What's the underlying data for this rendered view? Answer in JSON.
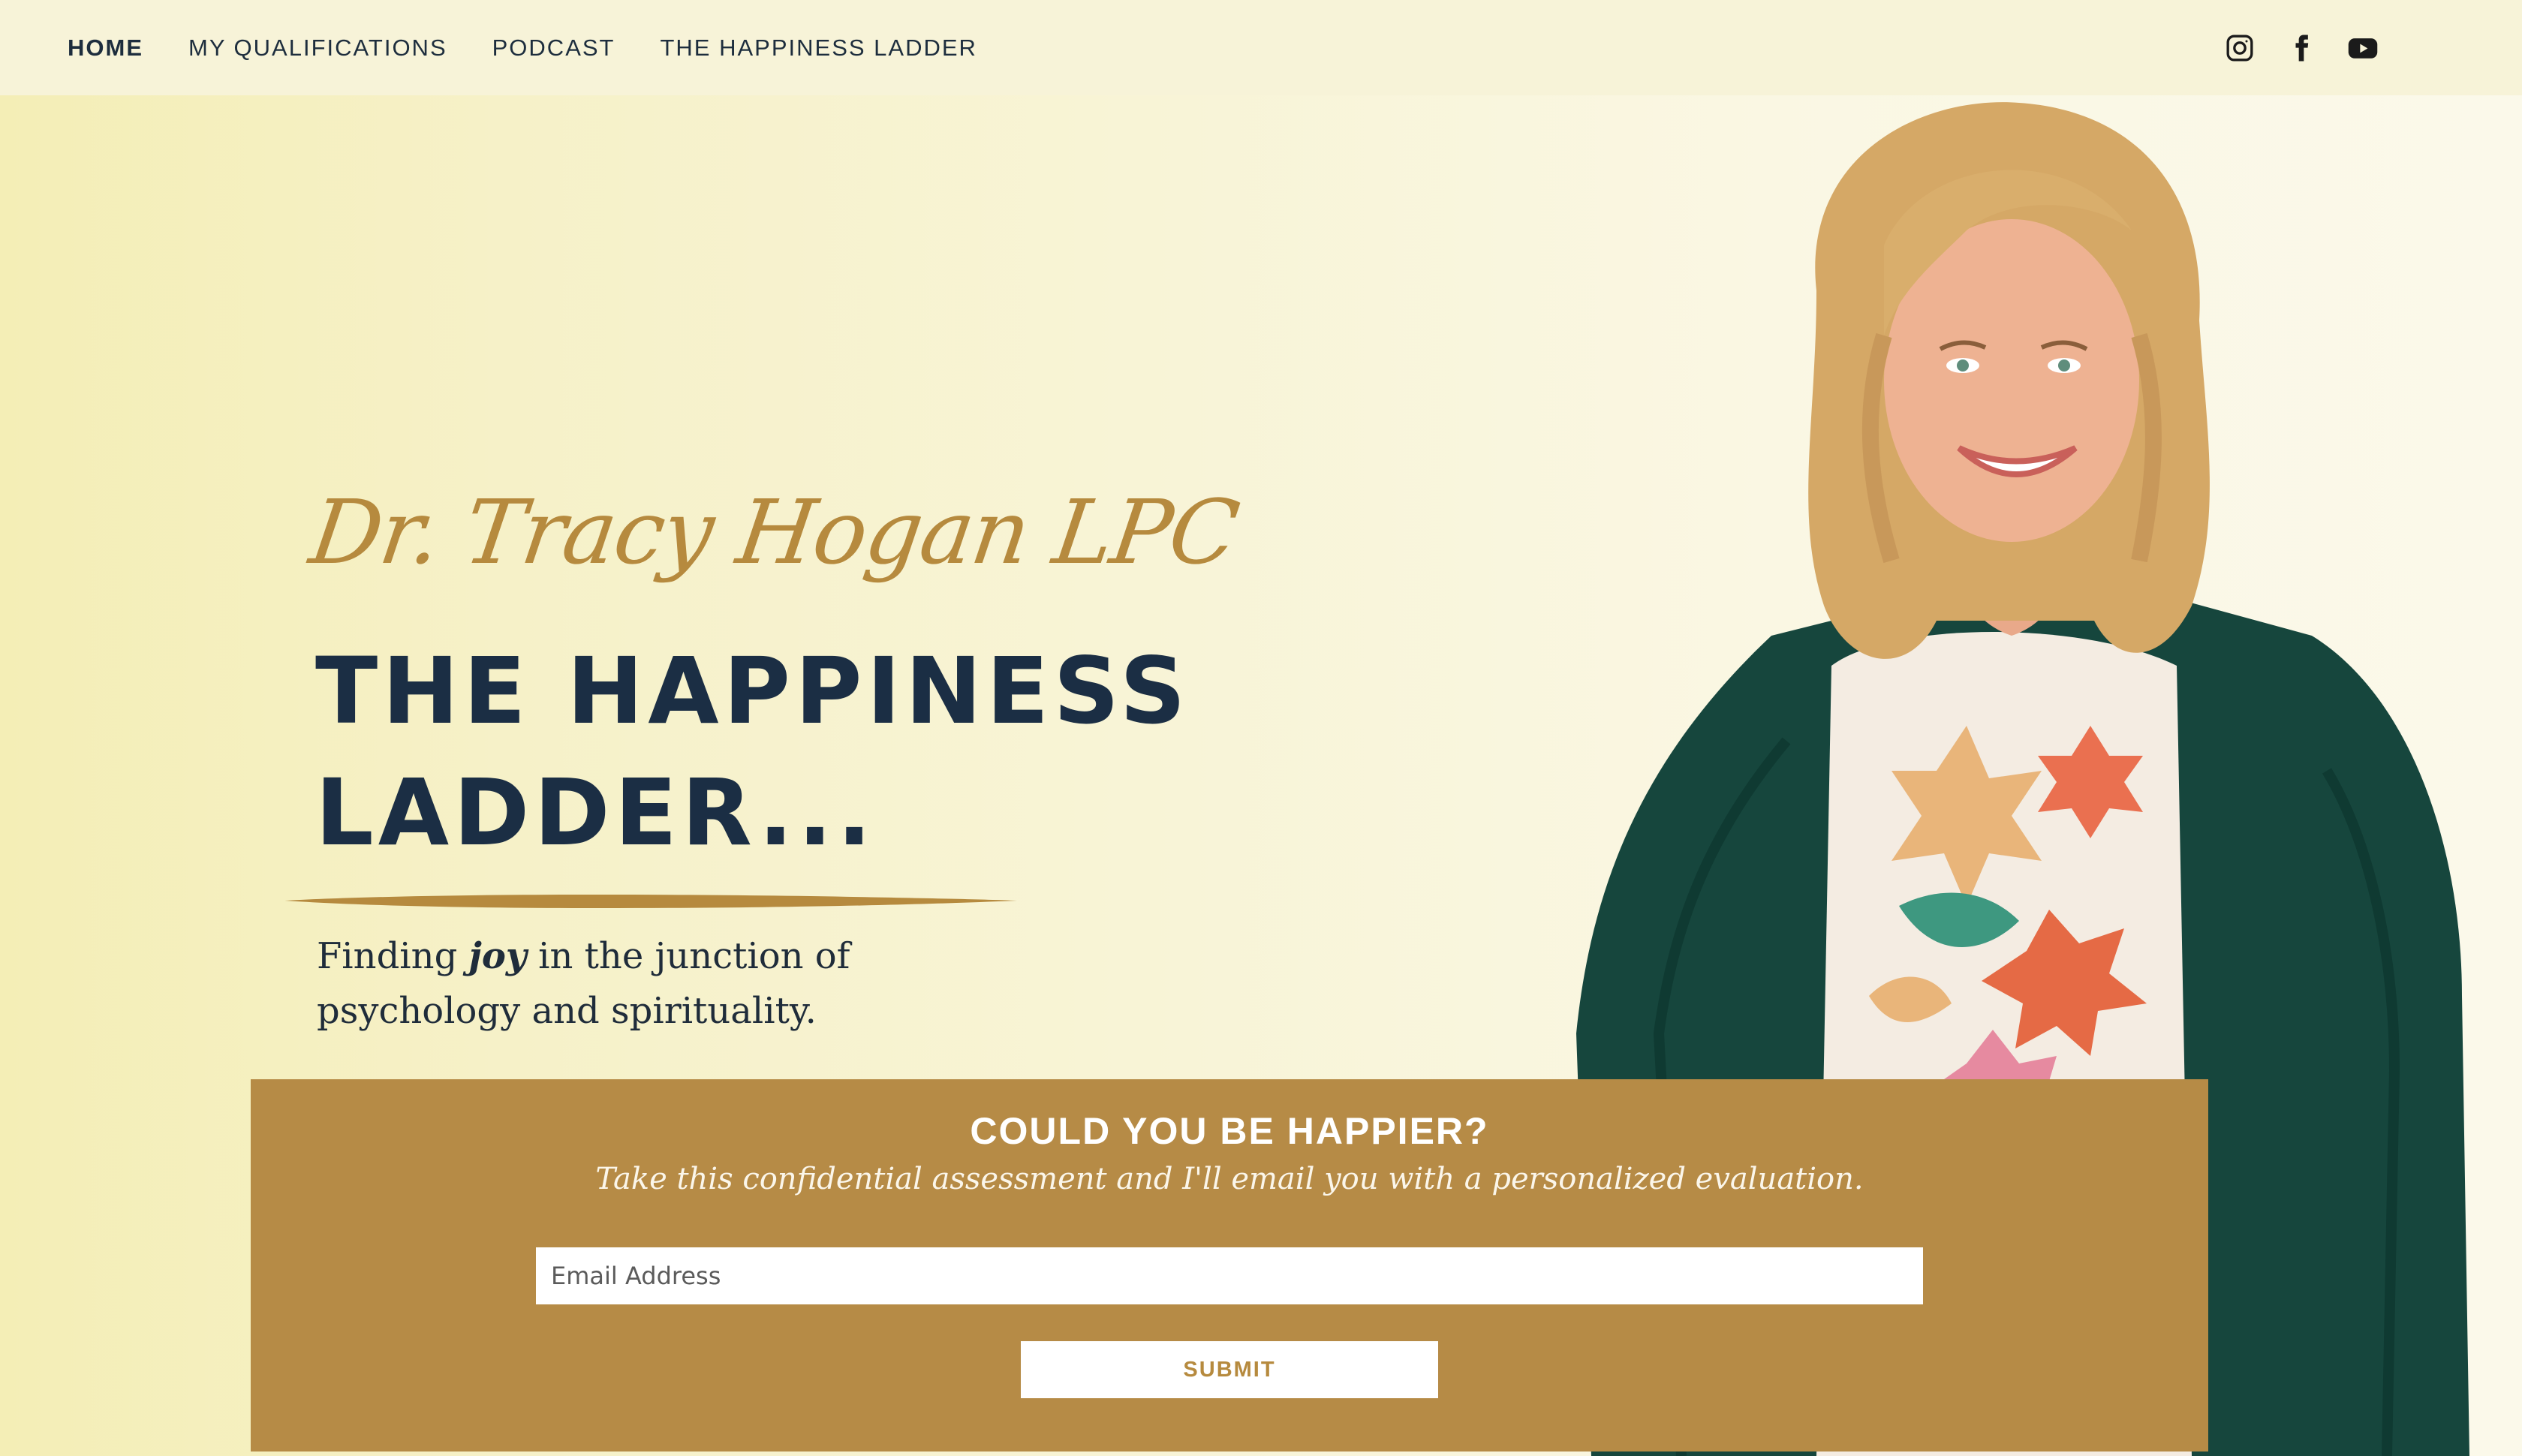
{
  "nav": {
    "items": [
      {
        "label": "HOME",
        "active": true
      },
      {
        "label": "MY QUALIFICATIONS",
        "active": false
      },
      {
        "label": "PODCAST",
        "active": false
      },
      {
        "label": "THE HAPPINESS LADDER",
        "active": false
      }
    ],
    "socials": [
      "instagram-icon",
      "facebook-icon",
      "youtube-icon"
    ]
  },
  "hero": {
    "signature": "Dr. Tracy Hogan LPC",
    "title_line1": "THE HAPPINESS",
    "title_line2": "LADDER...",
    "tagline_before": "Finding ",
    "tagline_emphasis": "joy",
    "tagline_after": " in the junction of psychology and spirituality."
  },
  "optin": {
    "heading": "COULD YOU BE HAPPIER?",
    "subheading": "Take this confidential assessment and I'll email you with a personalized evaluation.",
    "email_placeholder": "Email Address",
    "submit_label": "SUBMIT"
  },
  "colors": {
    "navy": "#1b2e44",
    "gold": "#b68b46",
    "background": "#f6f1c8"
  }
}
